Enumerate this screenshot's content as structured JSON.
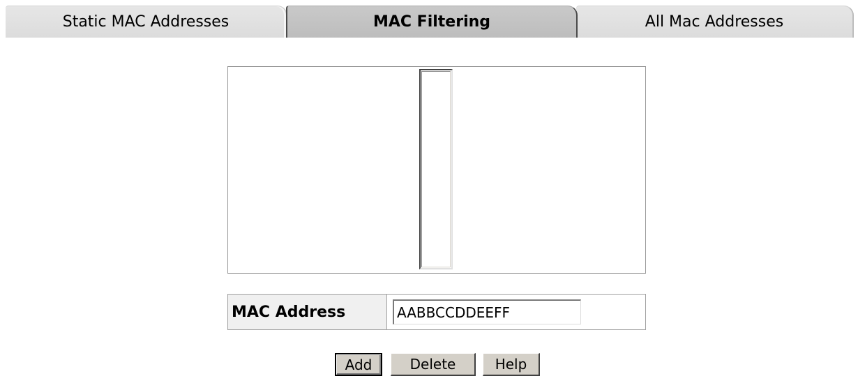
{
  "tabs": [
    {
      "label": "Static MAC Addresses",
      "active": false
    },
    {
      "label": "MAC Filtering",
      "active": true
    },
    {
      "label": "All Mac Addresses",
      "active": false
    }
  ],
  "mac_address": {
    "label": "MAC Address",
    "value": "AABBCCDDEEFF"
  },
  "buttons": {
    "add": "Add",
    "delete": "Delete",
    "help": "Help"
  },
  "colors": {
    "active_tab": "#c3c3c3",
    "inactive_tab": "#e0e0e0",
    "button_face": "#d4d0c8"
  }
}
